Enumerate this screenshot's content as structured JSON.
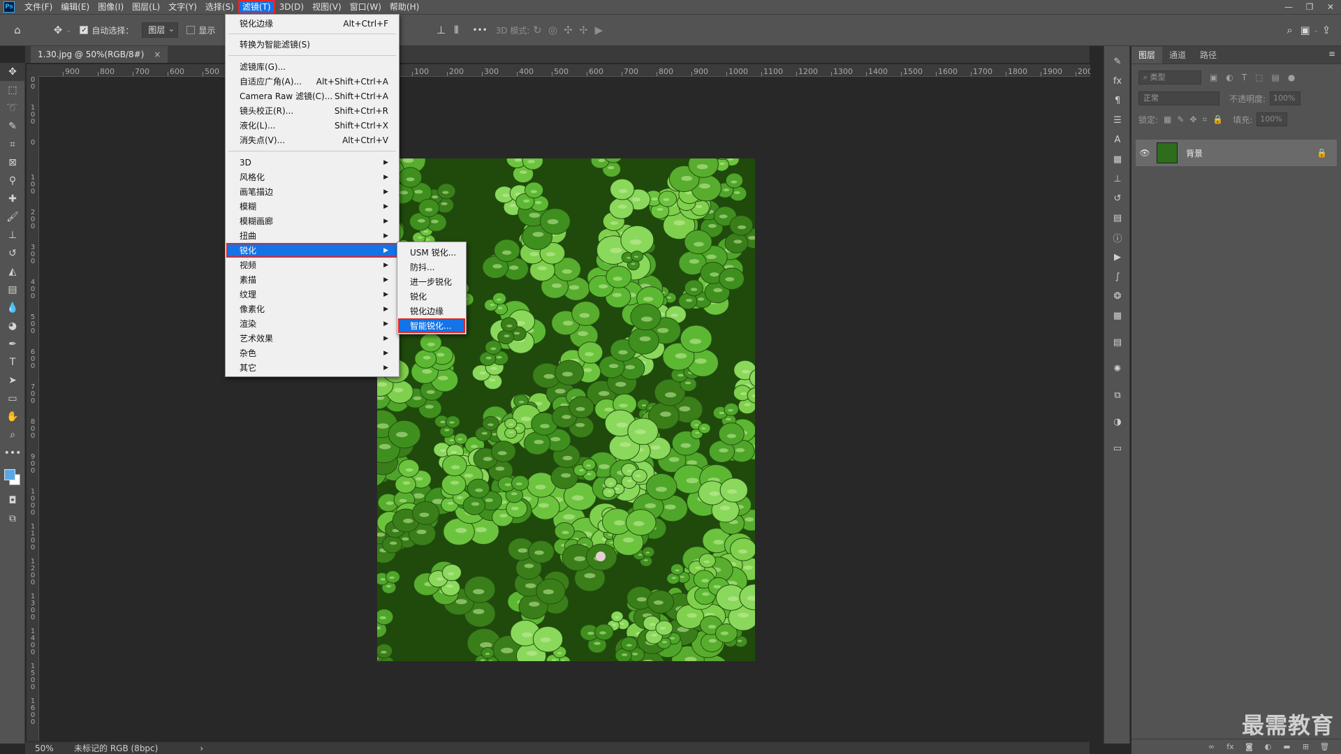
{
  "app": {
    "logo": "Ps",
    "menubar": [
      "文件(F)",
      "编辑(E)",
      "图像(I)",
      "图层(L)",
      "文字(Y)",
      "选择(S)",
      "滤镜(T)",
      "3D(D)",
      "视图(V)",
      "窗口(W)",
      "帮助(H)"
    ],
    "active_menu_index": 6,
    "window_controls": [
      "—",
      "❐",
      "✕"
    ]
  },
  "options": {
    "auto_select_label": "自动选择：",
    "auto_select_target": "图层",
    "show_label": "显示",
    "mode_label": "3D 模式:",
    "more": "•••"
  },
  "document": {
    "tab_title": "1.30.jpg @ 50%(RGB/8#)",
    "tab_close": "×"
  },
  "ruler": {
    "top_ticks": [
      "900",
      "800",
      "700",
      "600",
      "500",
      "100",
      "200",
      "300",
      "400",
      "500",
      "600",
      "700",
      "800",
      "900",
      "1000",
      "1100",
      "1200",
      "1300",
      "1400",
      "1500",
      "1600",
      "1700",
      "1800",
      "1900",
      "200"
    ],
    "left_ticks": [
      "200",
      "100",
      "0",
      "100",
      "200",
      "300",
      "400",
      "500",
      "600",
      "700",
      "800",
      "900",
      "1000",
      "1100",
      "1200",
      "1300",
      "1400",
      "1500",
      "1600"
    ]
  },
  "filter_menu": {
    "items": [
      {
        "label": "锐化边缘",
        "shortcut": "Alt+Ctrl+F"
      },
      {
        "label": "转换为智能滤镜(S)",
        "shortcut": ""
      },
      {
        "label": "滤镜库(G)...",
        "shortcut": ""
      },
      {
        "label": "自适应广角(A)...",
        "shortcut": "Alt+Shift+Ctrl+A"
      },
      {
        "label": "Camera Raw 滤镜(C)...",
        "shortcut": "Shift+Ctrl+A"
      },
      {
        "label": "镜头校正(R)...",
        "shortcut": "Shift+Ctrl+R"
      },
      {
        "label": "液化(L)...",
        "shortcut": "Shift+Ctrl+X"
      },
      {
        "label": "消失点(V)...",
        "shortcut": "Alt+Ctrl+V"
      }
    ],
    "submenus": [
      "3D",
      "风格化",
      "画笔描边",
      "模糊",
      "模糊画廊",
      "扭曲",
      "锐化",
      "视频",
      "素描",
      "纹理",
      "像素化",
      "渲染",
      "艺术效果",
      "杂色",
      "其它"
    ],
    "highlighted_submenu": "锐化"
  },
  "sharpen_submenu": {
    "items": [
      "USM 锐化...",
      "防抖...",
      "进一步锐化",
      "锐化",
      "锐化边缘",
      "智能锐化..."
    ],
    "highlighted": "智能锐化..."
  },
  "layers_panel": {
    "tabs": [
      "图层",
      "通道",
      "路径"
    ],
    "active_tab": "图层",
    "filter_placeholder": "类型",
    "blend_mode": "正常",
    "opacity_label": "不透明度:",
    "opacity_value": "100%",
    "lock_label": "锁定:",
    "fill_label": "填充:",
    "fill_value": "100%",
    "layer": {
      "name": "背景"
    }
  },
  "status": {
    "zoom": "50%",
    "info": "未标记的 RGB (8bpc)",
    "arrow": "›"
  },
  "watermark": "最需教育",
  "colors": {
    "ui_dark": "#282828",
    "panel": "#535353",
    "highlight": "#1473e6",
    "callout": "#e0262a",
    "foreground_swatch": "#5aa7e6"
  }
}
